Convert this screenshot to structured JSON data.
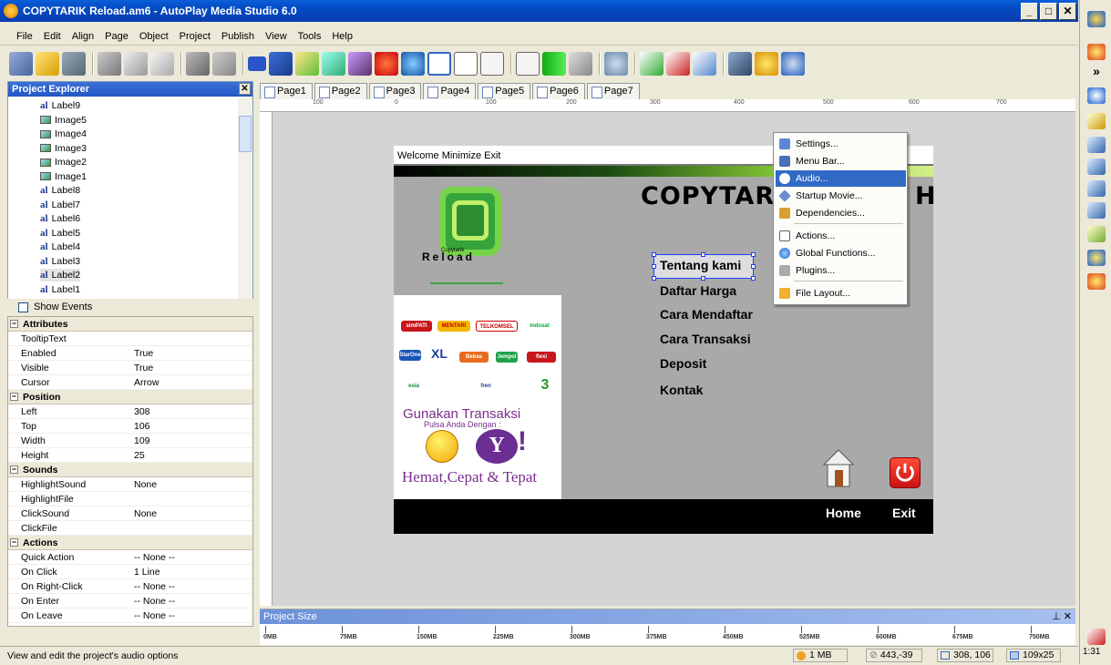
{
  "window": {
    "title": "COPYTARIK Reload.am6 - AutoPlay Media Studio 6.0",
    "min": "_",
    "max": "□",
    "close": "✕"
  },
  "menu": [
    "File",
    "Edit",
    "Align",
    "Page",
    "Object",
    "Project",
    "Publish",
    "View",
    "Tools",
    "Help"
  ],
  "project_explorer": {
    "title": "Project Explorer",
    "close": "✕",
    "items": [
      {
        "type": "label",
        "name": "Label9"
      },
      {
        "type": "image",
        "name": "Image5"
      },
      {
        "type": "image",
        "name": "Image4"
      },
      {
        "type": "image",
        "name": "Image3"
      },
      {
        "type": "image",
        "name": "Image2"
      },
      {
        "type": "image",
        "name": "Image1"
      },
      {
        "type": "label",
        "name": "Label8"
      },
      {
        "type": "label",
        "name": "Label7"
      },
      {
        "type": "label",
        "name": "Label6"
      },
      {
        "type": "label",
        "name": "Label5"
      },
      {
        "type": "label",
        "name": "Label4"
      },
      {
        "type": "label",
        "name": "Label3"
      },
      {
        "type": "label",
        "name": "Label2"
      },
      {
        "type": "label",
        "name": "Label1"
      }
    ],
    "label_glyph": "al",
    "selected": "Label2",
    "show_events": "Show Events"
  },
  "properties": [
    {
      "section": "Attributes"
    },
    {
      "k": "TooltipText",
      "v": ""
    },
    {
      "k": "Enabled",
      "v": "True"
    },
    {
      "k": "Visible",
      "v": "True"
    },
    {
      "k": "Cursor",
      "v": "Arrow"
    },
    {
      "section": "Position"
    },
    {
      "k": "Left",
      "v": "308"
    },
    {
      "k": "Top",
      "v": "106"
    },
    {
      "k": "Width",
      "v": "109"
    },
    {
      "k": "Height",
      "v": "25"
    },
    {
      "section": "Sounds"
    },
    {
      "k": "HighlightSound",
      "v": "None"
    },
    {
      "k": "HighlightFile",
      "v": ""
    },
    {
      "k": "ClickSound",
      "v": "None"
    },
    {
      "k": "ClickFile",
      "v": ""
    },
    {
      "section": "Actions"
    },
    {
      "k": "Quick Action",
      "v": "-- None --"
    },
    {
      "k": "On Click",
      "v": "1 Line"
    },
    {
      "k": "On Right-Click",
      "v": "-- None --"
    },
    {
      "k": "On Enter",
      "v": "-- None --"
    },
    {
      "k": "On Leave",
      "v": "-- None --"
    }
  ],
  "section_box": "−",
  "tabs": [
    "Page1",
    "Page2",
    "Page3",
    "Page4",
    "Page5",
    "Page6",
    "Page7"
  ],
  "ruler_marks": [
    "100",
    "0",
    "100",
    "200",
    "300",
    "400",
    "500",
    "600",
    "700"
  ],
  "page": {
    "title_menu": "Welcome  Minimize  Exit",
    "big_title": "COPYTAR",
    "big_title_tail": "H",
    "logo_small": "Copytarik",
    "logo_text": "Reload",
    "links": [
      "Tentang kami",
      "Daftar Harga",
      "Cara Mendaftar",
      "Cara Transaksi",
      "Deposit",
      "Kontak"
    ],
    "operators": [
      "simPATI",
      "MENTARI",
      "TELKOMSEL",
      "indosat",
      "StarOne",
      "XL",
      "flexi",
      "esia",
      "fren",
      "3",
      "Jempol",
      "Bebas"
    ],
    "promo_line1": "Gunakan Transaksi",
    "promo_line2": "Pulsa Anda Dengan :",
    "yahoo_letter": "Y",
    "yahoo_exclaim": "!",
    "promo_line3": "Hemat,Cepat & Tepat",
    "home_label": "Home",
    "exit_label": "Exit"
  },
  "context_menu": [
    "Settings...",
    "Menu Bar...",
    "Audio...",
    "Startup Movie...",
    "Dependencies...",
    "Actions...",
    "Global Functions...",
    "Plugins...",
    "File Layout..."
  ],
  "context_highlight": "Audio...",
  "project_size": {
    "title": "Project Size",
    "controls": "⊥ ✕",
    "ticks": [
      "0MB",
      "75MB",
      "150MB",
      "225MB",
      "300MB",
      "375MB",
      "450MB",
      "525MB",
      "600MB",
      "675MB",
      "750MB"
    ]
  },
  "status": {
    "message": "View and edit the project's audio options",
    "size": "1 MB",
    "cursor": "443,-39",
    "pos": "308, 106",
    "dims": "109x25"
  },
  "clock": "1:31"
}
